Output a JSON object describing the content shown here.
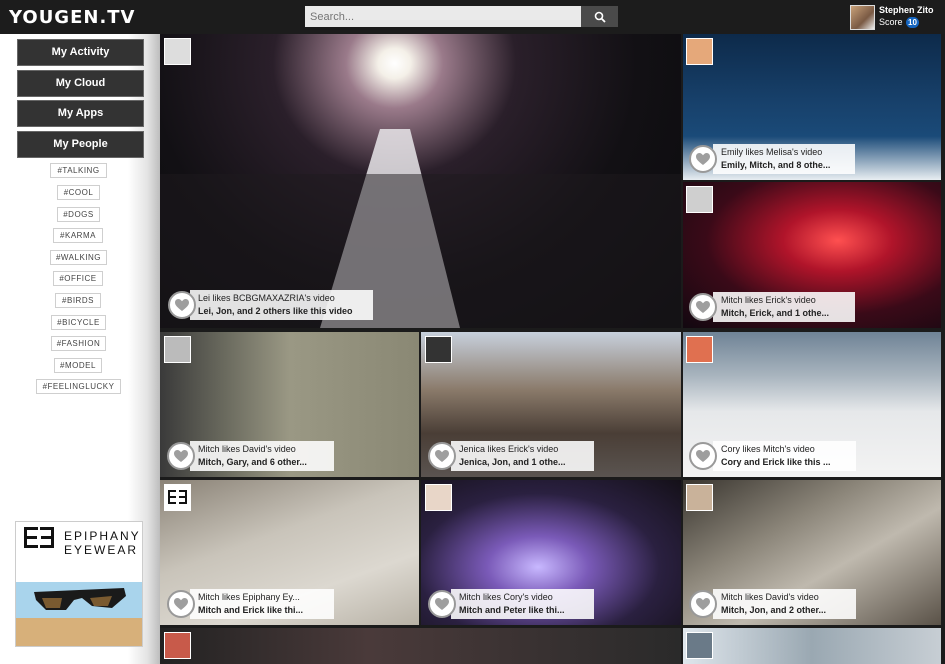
{
  "header": {
    "logo": "YOUGEN.TV",
    "search_placeholder": "Search...",
    "user_name": "Stephen Zito",
    "score_label": "Score",
    "score_value": "10",
    "search_icon": "search-icon"
  },
  "sidebar": {
    "nav": [
      "My Activity",
      "My Cloud",
      "My Apps",
      "My People"
    ],
    "tags": [
      "#TALKING",
      "#COOL",
      "#DOGS",
      "#KARMA",
      "#WALKING",
      "#OFFICE",
      "#BIRDS",
      "#BICYCLE",
      "#FASHION",
      "#MODEL",
      "#FEELINGLUCKY"
    ],
    "ad": {
      "line1": "EPIPHANY",
      "line2": "EYEWEAR"
    }
  },
  "videos": [
    {
      "line1": "Lei likes BCBGMAXAZRIA's video",
      "line2": "Lei, Jon, and 2 others like this video"
    },
    {
      "line1": "Emily likes Melisa's video",
      "line2": "Emily, Mitch, and 8 othe..."
    },
    {
      "line1": "Mitch likes Erick's video",
      "line2": "Mitch, Erick, and 1 othe..."
    },
    {
      "line1": "Mitch likes David's video",
      "line2": "Mitch, Gary, and 6 other..."
    },
    {
      "line1": "Jenica likes Erick's video",
      "line2": "Jenica, Jon, and 1 othe..."
    },
    {
      "line1": "Cory likes Mitch's video",
      "line2": "Cory and Erick like this ..."
    },
    {
      "line1": "Mitch likes Epiphany Ey...",
      "line2": "Mitch and Erick like thi..."
    },
    {
      "line1": "Mitch likes Cory's video",
      "line2": "Mitch and Peter like thi..."
    },
    {
      "line1": "Mitch likes David's video",
      "line2": "Mitch, Jon, and 2 other..."
    }
  ],
  "icons": {
    "like": "heart-icon",
    "search": "search-icon"
  }
}
